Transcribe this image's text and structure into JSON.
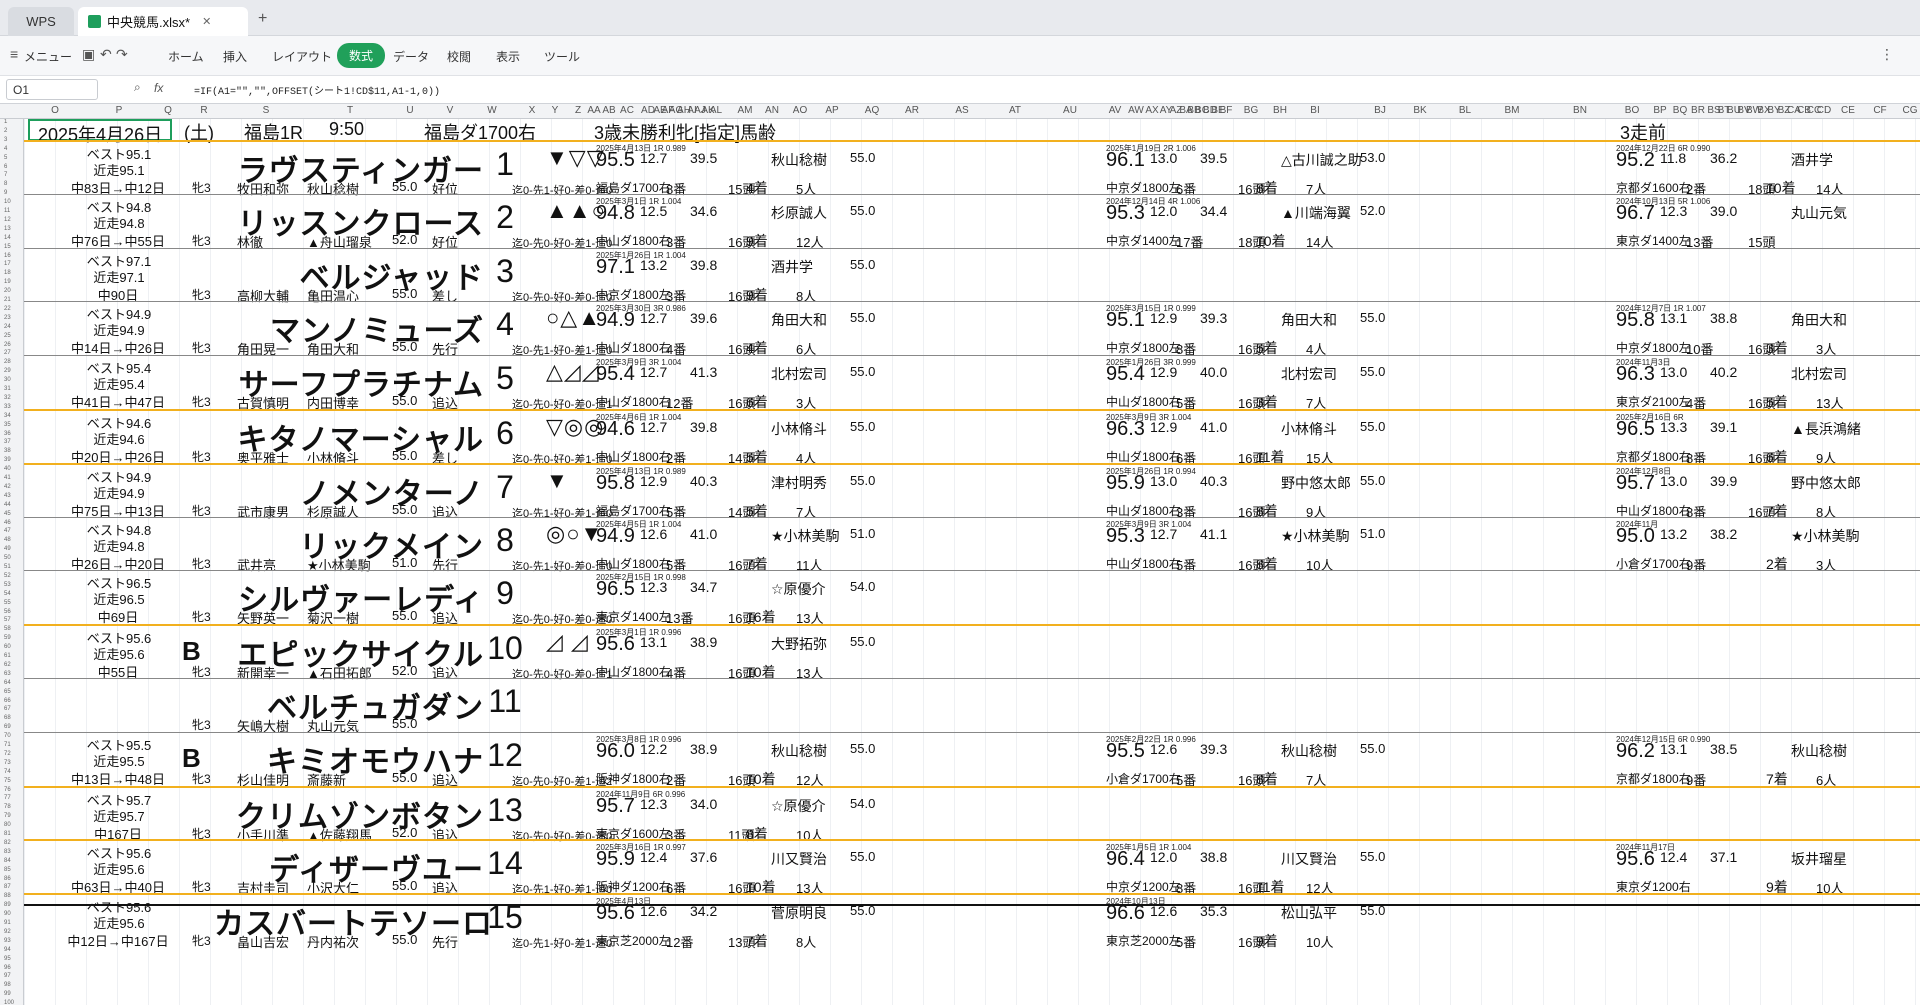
{
  "tabs": {
    "home": "WPS",
    "file": "中央競馬.xlsx*"
  },
  "menu": {
    "items": [
      "メニュー",
      "ホーム",
      "挿入",
      "レイアウト",
      "数式",
      "データ",
      "校閲",
      "表示",
      "ツール"
    ],
    "active": "数式"
  },
  "formula_bar": {
    "cell": "O1",
    "formula": "=IF(A1=\"\",\"\",OFFSET(シート1!CD$11,A1-1,0))"
  },
  "columns": [
    "O",
    "P",
    "Q",
    "R",
    "S",
    "T",
    "U",
    "V",
    "W",
    "X",
    "Y",
    "Z",
    "AA",
    "AB",
    "AC",
    "AD",
    "AE",
    "AF",
    "AG",
    "AH",
    "AI",
    "AJ",
    "AK",
    "AL",
    "AM",
    "AN",
    "AO",
    "AP",
    "AQ",
    "AR",
    "AS",
    "AT",
    "AU",
    "AV",
    "AW",
    "AX",
    "AY",
    "AZ",
    "BA",
    "BB",
    "BC",
    "BD",
    "BE",
    "BF",
    "BG",
    "BH",
    "BI",
    "BJ",
    "BK",
    "BL",
    "BM",
    "BN",
    "BO",
    "BP",
    "BQ",
    "BR",
    "BS",
    "BT",
    "BU",
    "BV",
    "BW",
    "BX",
    "BY",
    "BZ",
    "CA",
    "CB",
    "CC",
    "CD",
    "CE",
    "CF",
    "CG"
  ],
  "header": {
    "date": "2025年4月26日",
    "weekday": "(土)",
    "race": "福島1R",
    "time": "9:50",
    "course": "福島ダ1700右",
    "cond": "3歳未勝利牝[指定]馬齢",
    "prev": "3走前"
  },
  "horses": [
    {
      "best": "ベスト95.1",
      "recent": "近走95.1",
      "jump": "中83日→中12日",
      "blood": "",
      "name": "ラヴスティンガー",
      "num": "1",
      "marks": "▼▽▽",
      "sex": "牝3",
      "trainer": "牧田和弥",
      "jockey": "秋山稔樹",
      "wt": "55.0",
      "style": "好位",
      "record": "迄0-先1-好0-差0-追0",
      "r1": {
        "rt": "2025年4月13日 1R 0.989",
        "sc": "95.5",
        "f1": "12.7",
        "f2": "39.5",
        "j": "秋山稔樹",
        "w": "55.0",
        "cond": "福島ダ1700右",
        "pl": "8番",
        "of": "15頭",
        "fin": "4着",
        "fld": "5人"
      },
      "r2": {
        "rt": "2025年1月19日 2R 1.006",
        "sc": "96.1",
        "f1": "13.0",
        "f2": "39.5",
        "j": "△古川誠之助",
        "w": "53.0",
        "cond": "中京ダ1800左",
        "pl": "6番",
        "of": "16頭",
        "fin": "8着",
        "fld": "7人"
      },
      "r3": {
        "rt": "2024年12月22日 6R 0.990",
        "sc": "95.2",
        "f1": "11.8",
        "f2": "36.2",
        "j": "酒井学",
        "cond": "京都ダ1600右",
        "pl": "2番",
        "of": "18頭",
        "fin": "10着",
        "fld": "14人"
      }
    },
    {
      "best": "ベスト94.8",
      "recent": "近走94.8",
      "jump": "中76日→中55日",
      "blood": "",
      "name": "リッスンクロース",
      "num": "2",
      "marks": "▲▲○",
      "sex": "牝3",
      "trainer": "林徹",
      "jockey": "▲舟山瑠泉",
      "wt": "52.0",
      "style": "好位",
      "record": "迄0-先0-好0-差1-追0",
      "r1": {
        "rt": "2025年3月1日 1R 1.004",
        "sc": "94.8",
        "f1": "12.5",
        "f2": "34.6",
        "j": "杉原誠人",
        "w": "55.0",
        "cond": "中山ダ1800右",
        "pl": "3番",
        "of": "16頭",
        "fin": "9着",
        "fld": "12人"
      },
      "r2": {
        "rt": "2024年12月14日 4R 1.006",
        "sc": "95.3",
        "f1": "12.0",
        "f2": "34.4",
        "j": "▲川端海翼",
        "w": "52.0",
        "cond": "中京ダ1400左",
        "pl": "17番",
        "of": "18頭",
        "fin": "10着",
        "fld": "14人"
      },
      "r3": {
        "rt": "2024年10月13日 5R 1.006",
        "sc": "96.7",
        "f1": "12.3",
        "f2": "39.0",
        "j": "丸山元気",
        "cond": "東京ダ1400左",
        "pl": "13番",
        "of": "15頭",
        "fin": "",
        "fld": ""
      }
    },
    {
      "best": "ベスト97.1",
      "recent": "近走97.1",
      "jump": "中90日",
      "blood": "",
      "name": "ベルジャッド",
      "num": "3",
      "marks": "",
      "sex": "牝3",
      "trainer": "高柳大輔",
      "jockey": "亀田温心",
      "wt": "55.0",
      "style": "差し",
      "record": "迄0-先0-好0-差0-追0",
      "r1": {
        "rt": "2025年1月26日 1R 1.004",
        "sc": "97.1",
        "f1": "13.2",
        "f2": "39.8",
        "j": "酒井学",
        "w": "55.0",
        "cond": "中京ダ1800左",
        "pl": "3番",
        "of": "16頭",
        "fin": "9着",
        "fld": "8人"
      }
    },
    {
      "best": "ベスト94.9",
      "recent": "近走94.9",
      "jump": "中14日→中26日",
      "blood": "",
      "name": "マンノミューズ",
      "num": "4",
      "marks": "○△▲",
      "sex": "牝3",
      "trainer": "角田晃一",
      "jockey": "角田大和",
      "wt": "55.0",
      "style": "先行",
      "record": "迄0-先1-好0-差1-追0",
      "r1": {
        "rt": "2025年3月30日 3R 0.986",
        "sc": "94.9",
        "f1": "12.7",
        "f2": "39.6",
        "j": "角田大和",
        "w": "55.0",
        "cond": "中山ダ1800右",
        "pl": "4番",
        "of": "16頭",
        "fin": "4着",
        "fld": "6人"
      },
      "r2": {
        "rt": "2025年3月15日 1R 0.999",
        "sc": "95.1",
        "f1": "12.9",
        "f2": "39.3",
        "j": "角田大和",
        "w": "55.0",
        "cond": "中京ダ1800左",
        "pl": "8番",
        "of": "16頭",
        "fin": "5着",
        "fld": "4人"
      },
      "r3": {
        "rt": "2024年12月7日 1R 1.007",
        "sc": "95.8",
        "f1": "13.1",
        "f2": "38.8",
        "j": "角田大和",
        "cond": "中京ダ1800左",
        "pl": "10番",
        "of": "16頭",
        "fin": "3着",
        "fld": "3人"
      }
    },
    {
      "best": "ベスト95.4",
      "recent": "近走95.4",
      "jump": "中41日→中47日",
      "blood": "",
      "name": "サーフプラチナム",
      "num": "5",
      "marks": "△◿◿",
      "sex": "牝3",
      "trainer": "古賀慎明",
      "jockey": "内田博幸",
      "wt": "55.0",
      "style": "追込",
      "record": "迄0-先0-好0-差0-追1",
      "r1": {
        "rt": "2025年3月9日 3R 1.004",
        "sc": "95.4",
        "f1": "12.7",
        "f2": "41.3",
        "j": "北村宏司",
        "w": "55.0",
        "cond": "中山ダ1800右",
        "pl": "12番",
        "of": "16頭",
        "fin": "6着",
        "fld": "3人"
      },
      "r2": {
        "rt": "2025年1月26日 3R 0.999",
        "sc": "95.4",
        "f1": "12.9",
        "f2": "40.0",
        "j": "北村宏司",
        "w": "55.0",
        "cond": "中山ダ1800右",
        "pl": "5番",
        "of": "16頭",
        "fin": "3着",
        "fld": "7人"
      },
      "r3": {
        "rt": "2024年11月3日",
        "sc": "96.3",
        "f1": "13.0",
        "f2": "40.2",
        "j": "北村宏司",
        "cond": "東京ダ2100左",
        "pl": "4番",
        "of": "16頭",
        "fin": "5着",
        "fld": "13人"
      }
    },
    {
      "best": "ベスト94.6",
      "recent": "近走94.6",
      "jump": "中20日→中26日",
      "blood": "",
      "name": "キタノマーシャル",
      "num": "6",
      "marks": "▽◎◎",
      "sex": "牝3",
      "trainer": "奥平雅士",
      "jockey": "小林脩斗",
      "wt": "55.0",
      "style": "差し",
      "record": "迄0-先0-好0-差1-追0",
      "r1": {
        "rt": "2025年4月6日 1R 1.004",
        "sc": "94.6",
        "f1": "12.7",
        "f2": "39.8",
        "j": "小林脩斗",
        "w": "55.0",
        "cond": "中山ダ1800右",
        "pl": "2番",
        "of": "14頭",
        "fin": "5着",
        "fld": "4人"
      },
      "r2": {
        "rt": "2025年3月9日 3R 1.004",
        "sc": "96.3",
        "f1": "12.9",
        "f2": "41.0",
        "j": "小林脩斗",
        "w": "55.0",
        "cond": "中山ダ1800右",
        "pl": "6番",
        "of": "16頭",
        "fin": "11着",
        "fld": "15人"
      },
      "r3": {
        "rt": "2025年2月16日 6R",
        "sc": "96.5",
        "f1": "13.3",
        "f2": "39.1",
        "j": "▲長浜鴻緒",
        "cond": "京都ダ1800右",
        "pl": "8番",
        "of": "16頭",
        "fin": "6着",
        "fld": "9人"
      }
    },
    {
      "best": "ベスト94.9",
      "recent": "近走94.9",
      "jump": "中75日→中13日",
      "blood": "",
      "name": "ノメンターノ",
      "num": "7",
      "marks": "▼",
      "sex": "牝3",
      "trainer": "武市康男",
      "jockey": "杉原誠人",
      "wt": "55.0",
      "style": "追込",
      "record": "迄0-先1-好0-差1-追0",
      "r1": {
        "rt": "2025年4月13日 1R 0.989",
        "sc": "95.8",
        "f1": "12.9",
        "f2": "40.3",
        "j": "津村明秀",
        "w": "55.0",
        "cond": "福島ダ1700右",
        "pl": "5番",
        "of": "14頭",
        "fin": "5着",
        "fld": "7人"
      },
      "r2": {
        "rt": "2025年1月26日 1R 0.994",
        "sc": "95.9",
        "f1": "13.0",
        "f2": "40.3",
        "j": "野中悠太郎",
        "w": "55.0",
        "cond": "中山ダ1800右",
        "pl": "3番",
        "of": "16頭",
        "fin": "8着",
        "fld": "9人"
      },
      "r3": {
        "rt": "2024年12月8日",
        "sc": "95.7",
        "f1": "13.0",
        "f2": "39.9",
        "j": "野中悠太郎",
        "cond": "中山ダ1800右",
        "pl": "8番",
        "of": "16頭",
        "fin": "7着",
        "fld": "8人"
      }
    },
    {
      "best": "ベスト94.8",
      "recent": "近走94.8",
      "jump": "中26日→中20日",
      "blood": "",
      "name": "リックメイン",
      "num": "8",
      "marks": "◎○▼",
      "sex": "牝3",
      "trainer": "武井亮",
      "jockey": "★小林美駒",
      "wt": "51.0",
      "style": "先行",
      "record": "迄0-先1-好0-差0-追0",
      "r1": {
        "rt": "2025年4月5日 1R 1.004",
        "sc": "94.9",
        "f1": "12.6",
        "f2": "41.0",
        "j": "★小林美駒",
        "w": "51.0",
        "cond": "中山ダ1800右",
        "pl": "5番",
        "of": "16頭",
        "fin": "7着",
        "fld": "11人"
      },
      "r2": {
        "rt": "2025年3月9日 3R 1.004",
        "sc": "95.3",
        "f1": "12.7",
        "f2": "41.1",
        "j": "★小林美駒",
        "w": "51.0",
        "cond": "中山ダ1800右",
        "pl": "5番",
        "of": "16頭",
        "fin": "8着",
        "fld": "10人"
      },
      "r3": {
        "rt": "2024年11月",
        "sc": "95.0",
        "f1": "13.2",
        "f2": "38.2",
        "j": "★小林美駒",
        "cond": "小倉ダ1700右",
        "pl": "9番",
        "of": "",
        "fin": "2着",
        "fld": "3人"
      }
    },
    {
      "best": "ベスト96.5",
      "recent": "近走96.5",
      "jump": "中69日",
      "blood": "",
      "name": "シルヴァーレディ",
      "num": "9",
      "marks": "",
      "sex": "牝3",
      "trainer": "矢野英一",
      "jockey": "菊沢一樹",
      "wt": "55.0",
      "style": "追込",
      "record": "迄0-先0-好0-差0-追0",
      "r1": {
        "rt": "2025年2月15日 1R 0.998",
        "sc": "96.5",
        "f1": "12.3",
        "f2": "34.7",
        "j": "☆原優介",
        "w": "54.0",
        "cond": "東京ダ1400左",
        "pl": "13番",
        "of": "16頭",
        "fin": "16着",
        "fld": "13人"
      }
    },
    {
      "best": "ベスト95.6",
      "recent": "近走95.6",
      "jump": "中55日",
      "blood": "B",
      "name": "エピックサイクル",
      "num": "10",
      "marks": "◿ ◿",
      "sex": "牝3",
      "trainer": "新開幸一",
      "jockey": "▲石田拓郎",
      "wt": "52.0",
      "style": "追込",
      "record": "迄0-先0-好0-差0-追1",
      "r1": {
        "rt": "2025年3月1日 1R 0.996",
        "sc": "95.6",
        "f1": "13.1",
        "f2": "38.9",
        "j": "大野拓弥",
        "w": "55.0",
        "cond": "中山ダ1800右",
        "pl": "4番",
        "of": "16頭",
        "fin": "10着",
        "fld": "13人"
      }
    },
    {
      "best": "",
      "recent": "",
      "jump": "",
      "blood": "",
      "name": "ベルチュガダン",
      "num": "11",
      "marks": "",
      "sex": "牝3",
      "trainer": "矢嶋大樹",
      "jockey": "丸山元気",
      "wt": "55.0",
      "style": "",
      "record": ""
    },
    {
      "best": "ベスト95.5",
      "recent": "近走95.5",
      "jump": "中13日→中48日",
      "blood": "B",
      "name": "キミオモウハナ",
      "num": "12",
      "marks": "",
      "sex": "牝3",
      "trainer": "杉山佳明",
      "jockey": "斎藤新",
      "wt": "55.0",
      "style": "追込",
      "record": "迄0-先0-好0-差1-追2",
      "r1": {
        "rt": "2025年3月8日 1R 0.996",
        "sc": "96.0",
        "f1": "12.2",
        "f2": "38.9",
        "j": "秋山稔樹",
        "w": "55.0",
        "cond": "阪神ダ1800右",
        "pl": "2番",
        "of": "16頭",
        "fin": "10着",
        "fld": "12人"
      },
      "r2": {
        "rt": "2025年2月22日 1R 0.996",
        "sc": "95.5",
        "f1": "12.6",
        "f2": "39.3",
        "j": "秋山稔樹",
        "w": "55.0",
        "cond": "小倉ダ1700右",
        "pl": "5番",
        "of": "16頭",
        "fin": "8着",
        "fld": "7人"
      },
      "r3": {
        "rt": "2024年12月15日 6R 0.990",
        "sc": "96.2",
        "f1": "13.1",
        "f2": "38.5",
        "j": "秋山稔樹",
        "cond": "京都ダ1800右",
        "pl": "9番",
        "of": "",
        "fin": "7着",
        "fld": "6人"
      }
    },
    {
      "best": "ベスト95.7",
      "recent": "近走95.7",
      "jump": "中167日",
      "blood": "",
      "name": "クリムゾンボタン",
      "num": "13",
      "marks": "",
      "sex": "牝3",
      "trainer": "小手川準",
      "jockey": "▲佐藤翔馬",
      "wt": "52.0",
      "style": "追込",
      "record": "迄0-先0-好0-差0-追0",
      "r1": {
        "rt": "2024年11月9日 6R 0.996",
        "sc": "95.7",
        "f1": "12.3",
        "f2": "34.0",
        "j": "☆原優介",
        "w": "54.0",
        "cond": "東京ダ1600左",
        "pl": "3番",
        "of": "11頭",
        "fin": "8着",
        "fld": "10人"
      }
    },
    {
      "best": "ベスト95.6",
      "recent": "近走95.6",
      "jump": "中63日→中40日",
      "blood": "",
      "name": "ディザーヴユー",
      "num": "14",
      "marks": "",
      "sex": "牝3",
      "trainer": "吉村圭司",
      "jockey": "小沢大仁",
      "wt": "55.0",
      "style": "追込",
      "record": "迄0-先1-好0-差1-追0",
      "r1": {
        "rt": "2025年3月16日 1R 0.997",
        "sc": "95.9",
        "f1": "12.4",
        "f2": "37.6",
        "j": "川又賢治",
        "w": "55.0",
        "cond": "阪神ダ1200右",
        "pl": "6番",
        "of": "16頭",
        "fin": "10着",
        "fld": "13人"
      },
      "r2": {
        "rt": "2025年1月5日 1R 1.004",
        "sc": "96.4",
        "f1": "12.0",
        "f2": "38.8",
        "j": "川又賢治",
        "w": "55.0",
        "cond": "中京ダ1200左",
        "pl": "8番",
        "of": "16頭",
        "fin": "11着",
        "fld": "12人"
      },
      "r3": {
        "rt": "2024年11月17日",
        "sc": "95.6",
        "f1": "12.4",
        "f2": "37.1",
        "j": "坂井瑠星",
        "cond": "東京ダ1200右",
        "pl": "",
        "of": "",
        "fin": "9着",
        "fld": "10人"
      }
    },
    {
      "best": "ベスト95.6",
      "recent": "近走95.6",
      "jump": "中12日→中167日",
      "blood": "",
      "name": "カスバートテソーロ",
      "num": "15",
      "marks": "",
      "sex": "牝3",
      "trainer": "畠山吉宏",
      "jockey": "丹内祐次",
      "wt": "55.0",
      "style": "先行",
      "record": "迄0-先1-好0-差1-追0",
      "r1": {
        "rt": "2025年4月13日",
        "sc": "95.6",
        "f1": "12.6",
        "f2": "34.2",
        "j": "菅原明良",
        "w": "55.0",
        "cond": "東京芝2000左",
        "pl": "12番",
        "of": "13頭",
        "fin": "7着",
        "fld": "8人"
      },
      "r2": {
        "rt": "2024年10月13日",
        "sc": "96.6",
        "f1": "12.6",
        "f2": "35.3",
        "j": "松山弘平",
        "w": "55.0",
        "cond": "東京芝2000左",
        "pl": "5番",
        "of": "16頭",
        "fin": "9着",
        "fld": "10人"
      }
    }
  ]
}
